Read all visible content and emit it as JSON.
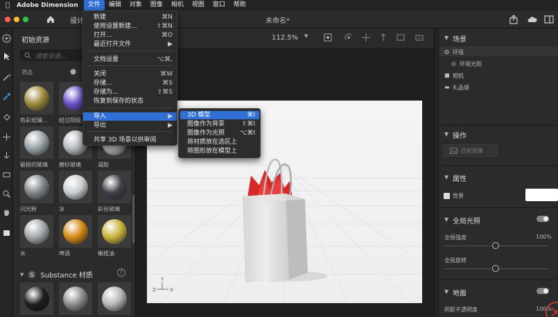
{
  "menubar": {
    "app_name": "Adobe Dimension",
    "items": [
      "文件",
      "编辑",
      "对象",
      "图像",
      "相机",
      "视图",
      "窗口",
      "帮助"
    ],
    "active_index": 0
  },
  "titlebar": {
    "tab": "设计",
    "document": "未命名*"
  },
  "left_panel": {
    "title": "初始资源",
    "search_placeholder": "搜索资源...",
    "filter_label": "筛选",
    "materials": [
      {
        "label": "色彩斑斓...",
        "color": "#9a8a3a"
      },
      {
        "label": "经过阳极...",
        "color": "#6a4fc8"
      },
      {
        "label": "破损的玻璃",
        "color": "#9aa3a8"
      },
      {
        "label": "磨砂玻璃",
        "color": "#b8bcbe"
      },
      {
        "label": "凝胶",
        "color": "#c7cacb"
      },
      {
        "label": "闪光粉",
        "color": "#7f8588"
      },
      {
        "label": "冰",
        "color": "#c9cdd0"
      },
      {
        "label": "彩丝玻璃",
        "color": "#3f3f4a"
      },
      {
        "label": "水",
        "color": "#a5a9ab"
      },
      {
        "label": "啤酒",
        "color": "#d48a14"
      },
      {
        "label": "橄榄油",
        "color": "#c9b23c"
      }
    ],
    "substance_header": "Substance 材质",
    "substance_colors": [
      "#1e1e1e",
      "#8c8c8c",
      "#b5b5b5"
    ]
  },
  "viewport": {
    "zoom": "112.5%",
    "axis_labels": [
      "Y",
      "Z",
      "X"
    ]
  },
  "file_menu": {
    "items": [
      {
        "label": "新建",
        "shortcut": "⌘N"
      },
      {
        "label": "使用设置新建...",
        "shortcut": "⇧⌘N"
      },
      {
        "label": "打开...",
        "shortcut": "⌘O"
      },
      {
        "label": "最近打开文件",
        "shortcut": "▶"
      },
      {
        "label": "文档设置",
        "shortcut": "⌥⌘,"
      },
      {
        "label": "关闭",
        "shortcut": "⌘W"
      },
      {
        "label": "存储...",
        "shortcut": "⌘S"
      },
      {
        "label": "存储为...",
        "shortcut": "⇧⌘S"
      },
      {
        "label": "恢复到保存的状态",
        "shortcut": ""
      },
      {
        "label": "导入",
        "shortcut": "▶"
      },
      {
        "label": "导出",
        "shortcut": "▶"
      },
      {
        "label": "共享 3D 场景以供审阅",
        "shortcut": ""
      }
    ]
  },
  "import_submenu": {
    "items": [
      {
        "label": "3D 模型",
        "shortcut": "⌘I"
      },
      {
        "label": "图像作为背景",
        "shortcut": "⇧⌘I"
      },
      {
        "label": "图像作为光照",
        "shortcut": "⌥⌘I"
      },
      {
        "label": "将材质放在选区上",
        "shortcut": ""
      },
      {
        "label": "将图形放在模型上",
        "shortcut": ""
      }
    ]
  },
  "right_panel": {
    "scene_title": "场景",
    "scene_items": [
      "环境",
      "环境光照",
      "相机",
      "礼品袋"
    ],
    "actions_title": "操作",
    "match_image": "匹配图像",
    "properties_title": "属性",
    "background_label": "背景",
    "global_light_title": "全局光照",
    "global_intensity": "全局强度",
    "global_intensity_value": "100%",
    "global_rotation": "全局旋转",
    "ground_title": "地面",
    "shadow_opacity": "阴影不透明度",
    "shadow_opacity_value": "100%"
  },
  "colors": {
    "accent": "#2f6fd6",
    "bag_red": "#d42a2a"
  }
}
